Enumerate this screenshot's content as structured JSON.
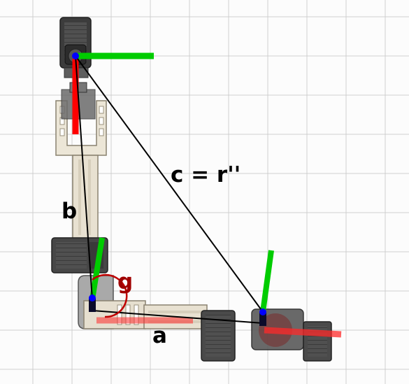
{
  "labels": {
    "side_c": "c = r''",
    "side_b": "b",
    "side_a": "a",
    "angle_g": "g"
  },
  "colors": {
    "triangle_lines": "#000000",
    "joint_points": "#0000ff",
    "angle_arc": "#c00000",
    "angle_label": "#a00000",
    "x_axis": "#ff0000",
    "y_axis": "#00cc00",
    "grid": "#cfcfcf",
    "arm_body": "#eae3d4",
    "servo_body": "#4a4a4a"
  }
}
